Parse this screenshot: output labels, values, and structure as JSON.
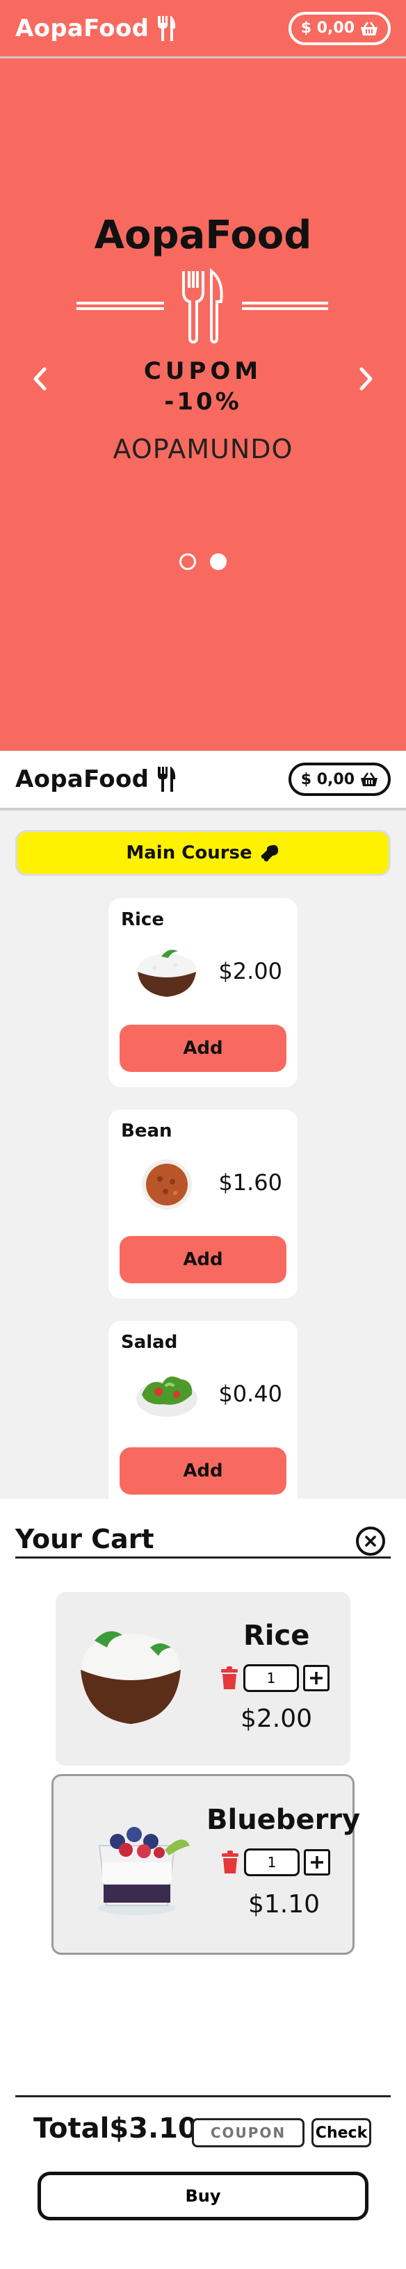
{
  "brand": {
    "name": "AopaFood"
  },
  "header": {
    "cart_total": "$ 0,00"
  },
  "hero": {
    "title": "AopaFood",
    "cupom": "CUPOM",
    "percent": "-10%",
    "code": "AOPAMUNDO",
    "slides": 2,
    "active_slide": 2
  },
  "menu": {
    "category": "Main Course",
    "items": [
      {
        "name": "Rice",
        "price": "$2.00",
        "add_label": "Add",
        "icon": "rice-bowl-icon"
      },
      {
        "name": "Bean",
        "price": "$1.60",
        "add_label": "Add",
        "icon": "beans-bowl-icon"
      },
      {
        "name": "Salad",
        "price": "$0.40",
        "add_label": "Add",
        "icon": "salad-bowl-icon"
      }
    ]
  },
  "cart": {
    "title": "Your Cart",
    "items": [
      {
        "name": "Rice",
        "qty": "1",
        "price": "$2.00",
        "icon": "rice-bowl-icon"
      },
      {
        "name": "Blueberry",
        "qty": "1",
        "price": "$1.10",
        "icon": "blueberry-dessert-icon"
      }
    ],
    "total_label": "Total",
    "total_value": "$3.10",
    "coupon_placeholder": "COUPON",
    "check_label": "Check",
    "buy_label": "Buy"
  },
  "colors": {
    "accent": "#f86a5f",
    "category_bg": "#fff200",
    "menu_bg": "#f1f1f1"
  }
}
